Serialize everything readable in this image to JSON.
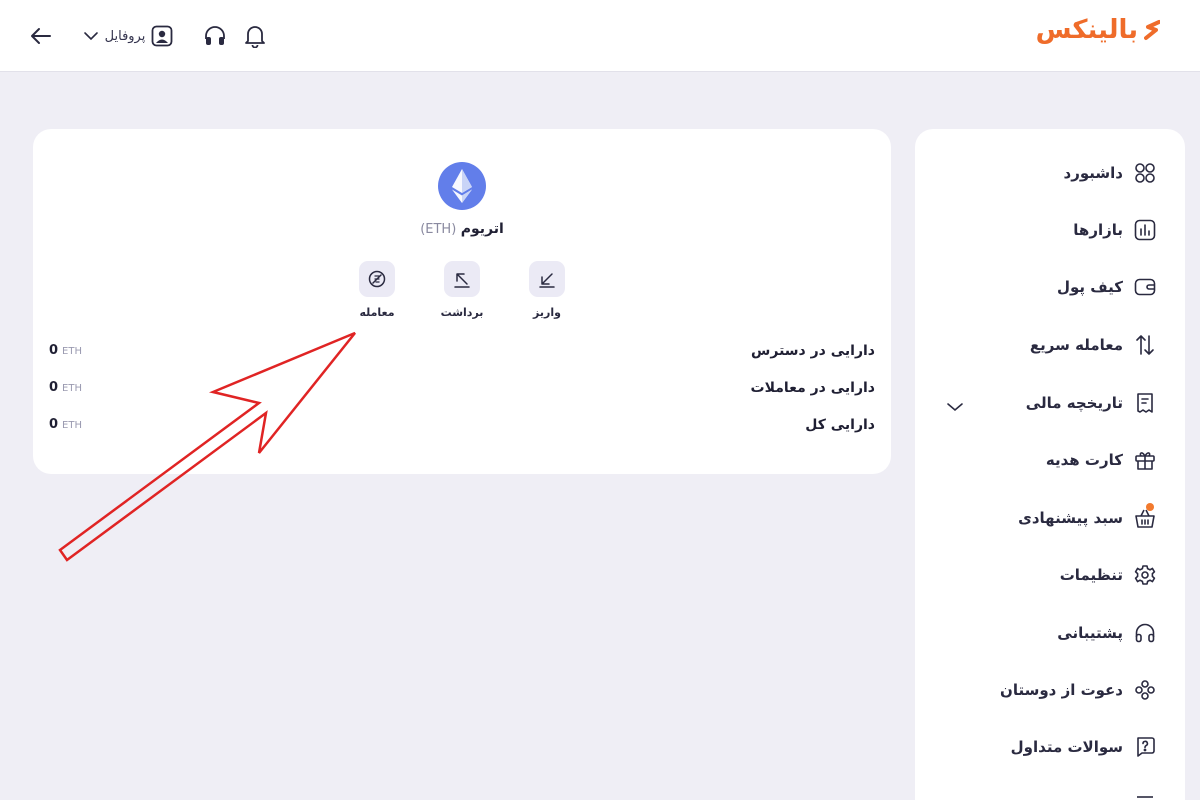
{
  "header": {
    "logo_text": "بالینکس",
    "profile_label": "پروفایل",
    "brand_color": "#ef6c2a"
  },
  "sidebar": {
    "items": [
      {
        "label": "داشبورد",
        "icon": "dashboard-grid-icon"
      },
      {
        "label": "بازارها",
        "icon": "markets-chart-icon"
      },
      {
        "label": "کیف پول",
        "icon": "wallet-icon"
      },
      {
        "label": "معامله سریع",
        "icon": "swap-arrows-icon"
      },
      {
        "label": "تاریخچه مالی",
        "icon": "receipt-icon"
      },
      {
        "label": "کارت هدیه",
        "icon": "gift-icon"
      },
      {
        "label": "سبد پیشنهادی",
        "icon": "basket-icon"
      },
      {
        "label": "تنظیمات",
        "icon": "gear-icon"
      },
      {
        "label": "پشتیبانی",
        "icon": "headphones-icon"
      },
      {
        "label": "دعوت از دوستان",
        "icon": "users-icon"
      },
      {
        "label": "سوالات متداول",
        "icon": "question-icon"
      }
    ]
  },
  "coin": {
    "name": "اتریوم",
    "symbol": "(ETH)",
    "color": "#627eea"
  },
  "actions": {
    "deposit": "واریز",
    "withdraw": "برداشت",
    "trade": "معامله"
  },
  "balances": [
    {
      "title": "دارایی در دسترس",
      "value": "0",
      "unit": "ETH"
    },
    {
      "title": "دارایی در معاملات",
      "value": "0",
      "unit": "ETH"
    },
    {
      "title": "دارایی کل",
      "value": "0",
      "unit": "ETH"
    }
  ],
  "annotation_color": "#e02424"
}
